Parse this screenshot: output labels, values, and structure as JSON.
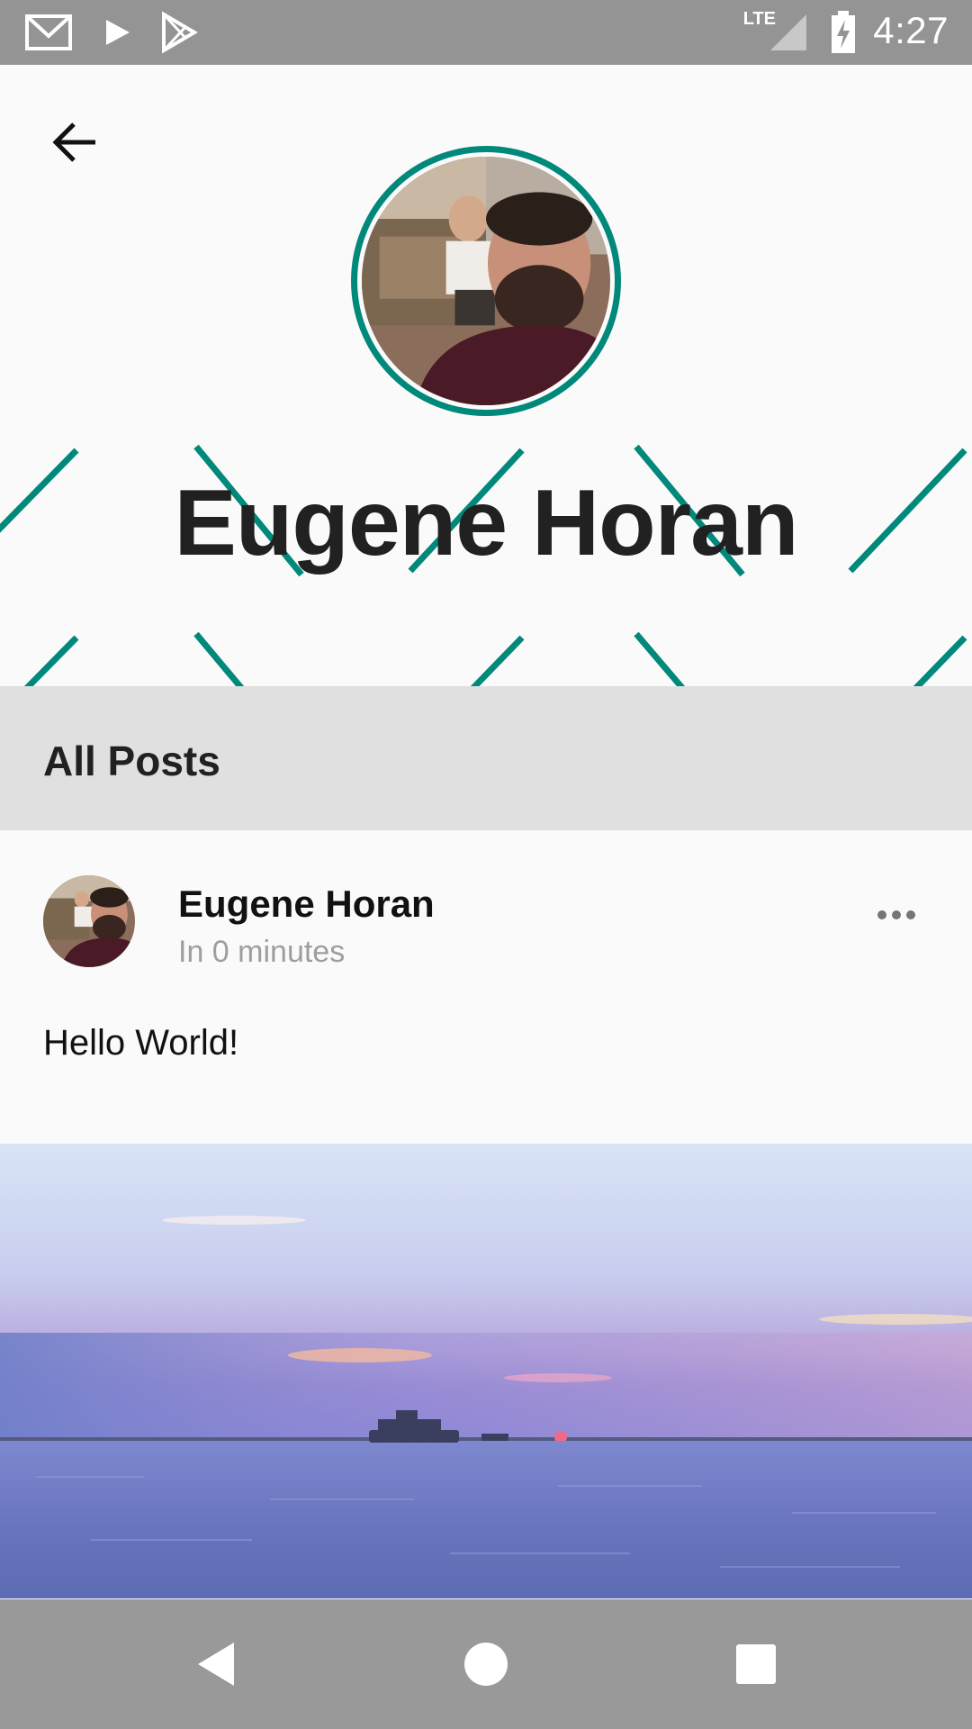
{
  "status_bar": {
    "time": "4:27",
    "network": "LTE",
    "icons": [
      "gmail-icon",
      "play-icon",
      "play-store-icon",
      "signal-icon",
      "battery-charging-icon"
    ]
  },
  "header": {
    "back_icon": "arrow-back-icon",
    "profile_name": "Eugene Horan",
    "accent_color": "#00897b"
  },
  "section": {
    "title": "All Posts"
  },
  "post": {
    "author": "Eugene Horan",
    "time": "In 0 minutes",
    "text": "Hello World!",
    "menu_icon": "more-horizontal-icon"
  },
  "nav_bar": {
    "buttons": [
      "back-triangle-icon",
      "home-circle-icon",
      "recents-square-icon"
    ]
  }
}
